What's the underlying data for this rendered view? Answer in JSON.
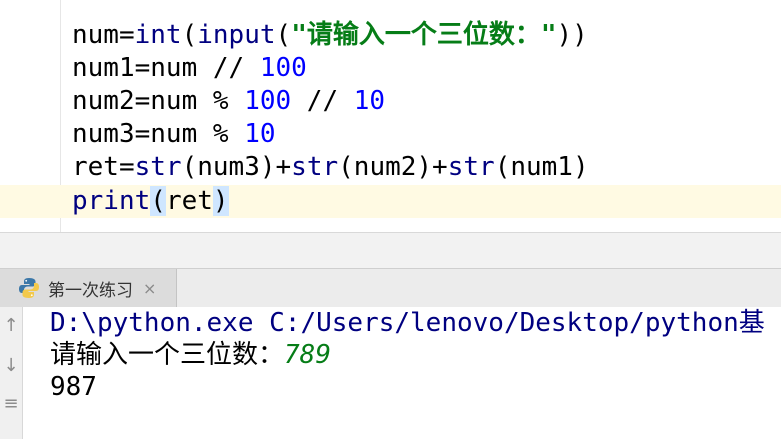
{
  "editor": {
    "lines": [
      {
        "t1": "num=",
        "t2": "int",
        "t3": "(",
        "t4": "input",
        "t5": "(",
        "t6": "\"请输入一个三位数：\"",
        "t7": "))"
      },
      {
        "t1": "num1=num // ",
        "t2": "100"
      },
      {
        "t1": "num2=num % ",
        "t2": "100",
        "t3": " // ",
        "t4": "10"
      },
      {
        "t1": "num3=num % ",
        "t2": "10"
      },
      {
        "t1": "ret=",
        "t2": "str",
        "t3": "(num3)+",
        "t4": "str",
        "t5": "(num2)+",
        "t6": "str",
        "t7": "(num1)"
      },
      {
        "t1": "print",
        "t2": "(",
        "t3": "ret",
        "t4": ")"
      }
    ]
  },
  "run_panel": {
    "tab_label": "第一次练习",
    "tab_icon": "python-icon",
    "close_glyph": "×"
  },
  "console": {
    "command": "D:\\python.exe C:/Users/lenovo/Desktop/python基",
    "prompt": "请输入一个三位数：",
    "user_input": "789",
    "output": "987"
  }
}
